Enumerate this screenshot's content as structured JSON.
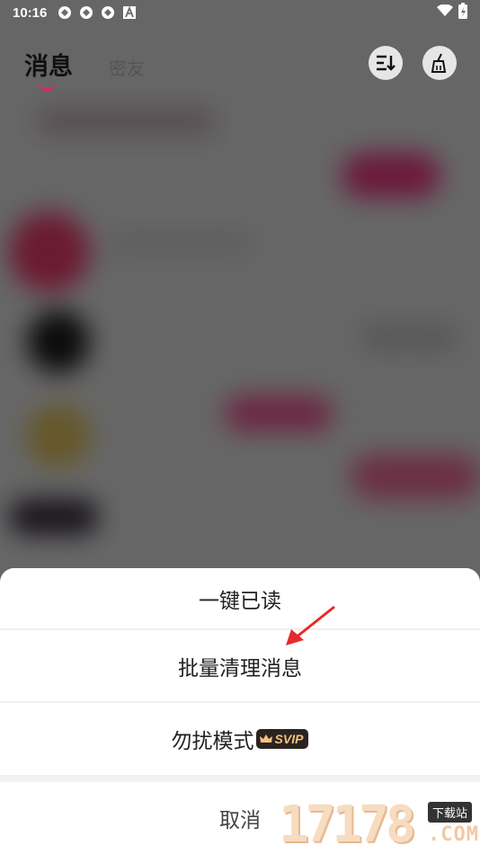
{
  "status_bar": {
    "time": "10:16",
    "icons": [
      "app-notification-icon",
      "app-notification-icon",
      "app-notification-icon",
      "a-notification-icon"
    ],
    "right_icons": [
      "wifi-icon",
      "battery-charging-icon"
    ]
  },
  "header": {
    "tabs": [
      {
        "label": "消息",
        "active": true
      },
      {
        "label": "密友",
        "active": false
      }
    ],
    "right_icons": [
      "sort-icon",
      "broom-clean-icon"
    ],
    "accent_color": "#e0245e"
  },
  "action_sheet": {
    "items": [
      {
        "label": "一键已读"
      },
      {
        "label": "批量清理消息"
      },
      {
        "label": "勿扰模式",
        "badge": "SVIP"
      }
    ],
    "cancel_label": "取消"
  },
  "annotation": {
    "type": "red-arrow",
    "points_to": "批量清理消息",
    "color": "#e52b2b"
  },
  "watermark": {
    "digits": "17178",
    "tag": "下载站",
    "domain": ".COM"
  }
}
